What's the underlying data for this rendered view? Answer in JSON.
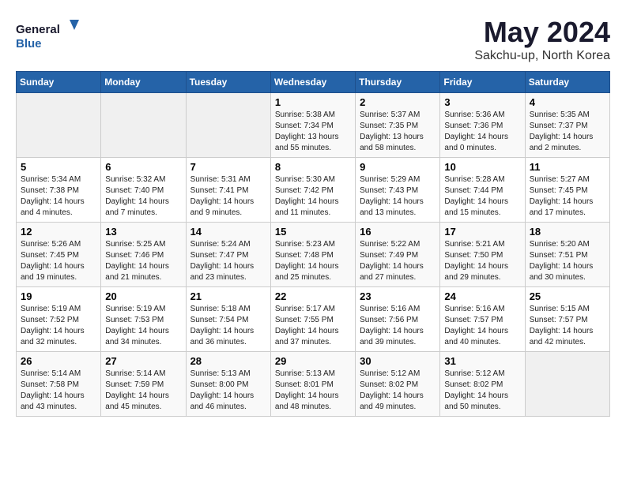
{
  "header": {
    "logo_line1": "General",
    "logo_line2": "Blue",
    "month": "May 2024",
    "location": "Sakchu-up, North Korea"
  },
  "weekdays": [
    "Sunday",
    "Monday",
    "Tuesday",
    "Wednesday",
    "Thursday",
    "Friday",
    "Saturday"
  ],
  "weeks": [
    [
      {
        "day": "",
        "sunrise": "",
        "sunset": "",
        "daylight": ""
      },
      {
        "day": "",
        "sunrise": "",
        "sunset": "",
        "daylight": ""
      },
      {
        "day": "",
        "sunrise": "",
        "sunset": "",
        "daylight": ""
      },
      {
        "day": "1",
        "sunrise": "Sunrise: 5:38 AM",
        "sunset": "Sunset: 7:34 PM",
        "daylight": "Daylight: 13 hours and 55 minutes."
      },
      {
        "day": "2",
        "sunrise": "Sunrise: 5:37 AM",
        "sunset": "Sunset: 7:35 PM",
        "daylight": "Daylight: 13 hours and 58 minutes."
      },
      {
        "day": "3",
        "sunrise": "Sunrise: 5:36 AM",
        "sunset": "Sunset: 7:36 PM",
        "daylight": "Daylight: 14 hours and 0 minutes."
      },
      {
        "day": "4",
        "sunrise": "Sunrise: 5:35 AM",
        "sunset": "Sunset: 7:37 PM",
        "daylight": "Daylight: 14 hours and 2 minutes."
      }
    ],
    [
      {
        "day": "5",
        "sunrise": "Sunrise: 5:34 AM",
        "sunset": "Sunset: 7:38 PM",
        "daylight": "Daylight: 14 hours and 4 minutes."
      },
      {
        "day": "6",
        "sunrise": "Sunrise: 5:32 AM",
        "sunset": "Sunset: 7:40 PM",
        "daylight": "Daylight: 14 hours and 7 minutes."
      },
      {
        "day": "7",
        "sunrise": "Sunrise: 5:31 AM",
        "sunset": "Sunset: 7:41 PM",
        "daylight": "Daylight: 14 hours and 9 minutes."
      },
      {
        "day": "8",
        "sunrise": "Sunrise: 5:30 AM",
        "sunset": "Sunset: 7:42 PM",
        "daylight": "Daylight: 14 hours and 11 minutes."
      },
      {
        "day": "9",
        "sunrise": "Sunrise: 5:29 AM",
        "sunset": "Sunset: 7:43 PM",
        "daylight": "Daylight: 14 hours and 13 minutes."
      },
      {
        "day": "10",
        "sunrise": "Sunrise: 5:28 AM",
        "sunset": "Sunset: 7:44 PM",
        "daylight": "Daylight: 14 hours and 15 minutes."
      },
      {
        "day": "11",
        "sunrise": "Sunrise: 5:27 AM",
        "sunset": "Sunset: 7:45 PM",
        "daylight": "Daylight: 14 hours and 17 minutes."
      }
    ],
    [
      {
        "day": "12",
        "sunrise": "Sunrise: 5:26 AM",
        "sunset": "Sunset: 7:45 PM",
        "daylight": "Daylight: 14 hours and 19 minutes."
      },
      {
        "day": "13",
        "sunrise": "Sunrise: 5:25 AM",
        "sunset": "Sunset: 7:46 PM",
        "daylight": "Daylight: 14 hours and 21 minutes."
      },
      {
        "day": "14",
        "sunrise": "Sunrise: 5:24 AM",
        "sunset": "Sunset: 7:47 PM",
        "daylight": "Daylight: 14 hours and 23 minutes."
      },
      {
        "day": "15",
        "sunrise": "Sunrise: 5:23 AM",
        "sunset": "Sunset: 7:48 PM",
        "daylight": "Daylight: 14 hours and 25 minutes."
      },
      {
        "day": "16",
        "sunrise": "Sunrise: 5:22 AM",
        "sunset": "Sunset: 7:49 PM",
        "daylight": "Daylight: 14 hours and 27 minutes."
      },
      {
        "day": "17",
        "sunrise": "Sunrise: 5:21 AM",
        "sunset": "Sunset: 7:50 PM",
        "daylight": "Daylight: 14 hours and 29 minutes."
      },
      {
        "day": "18",
        "sunrise": "Sunrise: 5:20 AM",
        "sunset": "Sunset: 7:51 PM",
        "daylight": "Daylight: 14 hours and 30 minutes."
      }
    ],
    [
      {
        "day": "19",
        "sunrise": "Sunrise: 5:19 AM",
        "sunset": "Sunset: 7:52 PM",
        "daylight": "Daylight: 14 hours and 32 minutes."
      },
      {
        "day": "20",
        "sunrise": "Sunrise: 5:19 AM",
        "sunset": "Sunset: 7:53 PM",
        "daylight": "Daylight: 14 hours and 34 minutes."
      },
      {
        "day": "21",
        "sunrise": "Sunrise: 5:18 AM",
        "sunset": "Sunset: 7:54 PM",
        "daylight": "Daylight: 14 hours and 36 minutes."
      },
      {
        "day": "22",
        "sunrise": "Sunrise: 5:17 AM",
        "sunset": "Sunset: 7:55 PM",
        "daylight": "Daylight: 14 hours and 37 minutes."
      },
      {
        "day": "23",
        "sunrise": "Sunrise: 5:16 AM",
        "sunset": "Sunset: 7:56 PM",
        "daylight": "Daylight: 14 hours and 39 minutes."
      },
      {
        "day": "24",
        "sunrise": "Sunrise: 5:16 AM",
        "sunset": "Sunset: 7:57 PM",
        "daylight": "Daylight: 14 hours and 40 minutes."
      },
      {
        "day": "25",
        "sunrise": "Sunrise: 5:15 AM",
        "sunset": "Sunset: 7:57 PM",
        "daylight": "Daylight: 14 hours and 42 minutes."
      }
    ],
    [
      {
        "day": "26",
        "sunrise": "Sunrise: 5:14 AM",
        "sunset": "Sunset: 7:58 PM",
        "daylight": "Daylight: 14 hours and 43 minutes."
      },
      {
        "day": "27",
        "sunrise": "Sunrise: 5:14 AM",
        "sunset": "Sunset: 7:59 PM",
        "daylight": "Daylight: 14 hours and 45 minutes."
      },
      {
        "day": "28",
        "sunrise": "Sunrise: 5:13 AM",
        "sunset": "Sunset: 8:00 PM",
        "daylight": "Daylight: 14 hours and 46 minutes."
      },
      {
        "day": "29",
        "sunrise": "Sunrise: 5:13 AM",
        "sunset": "Sunset: 8:01 PM",
        "daylight": "Daylight: 14 hours and 48 minutes."
      },
      {
        "day": "30",
        "sunrise": "Sunrise: 5:12 AM",
        "sunset": "Sunset: 8:02 PM",
        "daylight": "Daylight: 14 hours and 49 minutes."
      },
      {
        "day": "31",
        "sunrise": "Sunrise: 5:12 AM",
        "sunset": "Sunset: 8:02 PM",
        "daylight": "Daylight: 14 hours and 50 minutes."
      },
      {
        "day": "",
        "sunrise": "",
        "sunset": "",
        "daylight": ""
      }
    ]
  ]
}
